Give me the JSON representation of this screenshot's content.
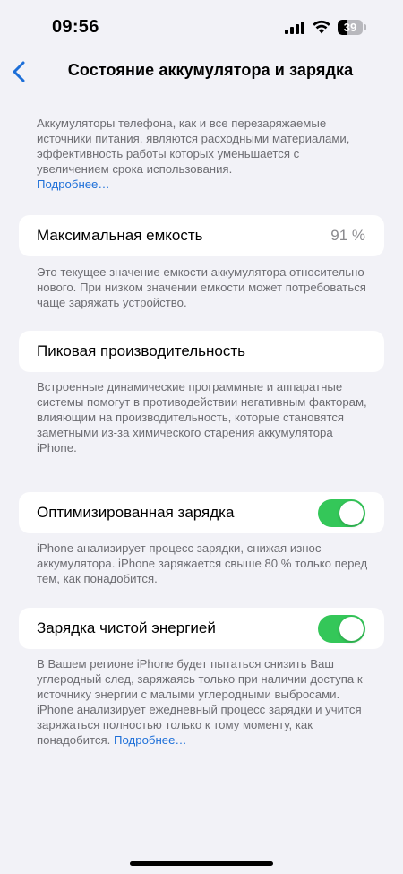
{
  "status_bar": {
    "time": "09:56",
    "battery_percent": "39",
    "battery_level": 0.39
  },
  "nav": {
    "title": "Состояние аккумулятора и зарядка"
  },
  "intro": {
    "text": "Аккумуляторы телефона, как и все перезаряжаемые источники питания, являются расходными материалами, эффективность работы которых уменьшается с увеличением срока использования.",
    "link": "Подробнее…"
  },
  "max_capacity": {
    "label": "Максимальная емкость",
    "value": "91 %",
    "description": "Это текущее значение емкости аккумулятора относительно нового. При низком значении емкости может потребоваться чаще заряжать устройство."
  },
  "peak_performance": {
    "label": "Пиковая производительность",
    "description": "Встроенные динамические программные и аппаратные системы помогут в противодействии негативным факторам, влияющим на производительность, которые становятся заметными из-за химического старения аккумулятора iPhone."
  },
  "optimized_charging": {
    "label": "Оптимизированная зарядка",
    "enabled": true,
    "description": "iPhone анализирует процесс зарядки, снижая износ аккумулятора. iPhone заряжается свыше 80 % только перед тем, как понадобится."
  },
  "clean_energy": {
    "label": "Зарядка чистой энергией",
    "enabled": true,
    "description": "В Вашем регионе iPhone будет пытаться снизить Ваш углеродный след, заряжаясь только при наличии доступа к источнику энергии с малыми углеродными выбросами. iPhone анализирует ежедневный процесс зарядки и учится заряжаться полностью только к тому моменту, как понадобится.",
    "link": "Подробнее…"
  },
  "colors": {
    "accent": "#1d6fd8",
    "toggle_on": "#34c759",
    "background": "#f2f2f7"
  }
}
